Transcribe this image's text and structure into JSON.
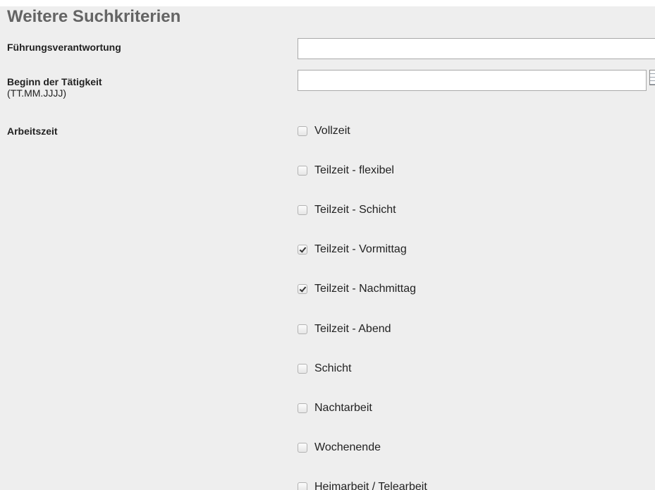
{
  "section": {
    "title": "Weitere Suchkriterien"
  },
  "fields": {
    "leadership": {
      "label": "Führungsverantwortung",
      "value": ""
    },
    "start_date": {
      "label": "Beginn der Tätigkeit",
      "hint": "(TT.MM.JJJJ)",
      "value": "",
      "picker_icon": "calendar-icon"
    },
    "working_time": {
      "label": "Arbeitszeit",
      "options": [
        {
          "label": "Vollzeit",
          "checked": false
        },
        {
          "label": "Teilzeit - flexibel",
          "checked": false
        },
        {
          "label": "Teilzeit - Schicht",
          "checked": false
        },
        {
          "label": "Teilzeit - Vormittag",
          "checked": true
        },
        {
          "label": "Teilzeit - Nachmittag",
          "checked": true
        },
        {
          "label": "Teilzeit - Abend",
          "checked": false
        },
        {
          "label": "Schicht",
          "checked": false
        },
        {
          "label": "Nachtarbeit",
          "checked": false
        },
        {
          "label": "Wochenende",
          "checked": false
        },
        {
          "label": "Heimarbeit / Telearbeit",
          "checked": false
        }
      ]
    }
  }
}
